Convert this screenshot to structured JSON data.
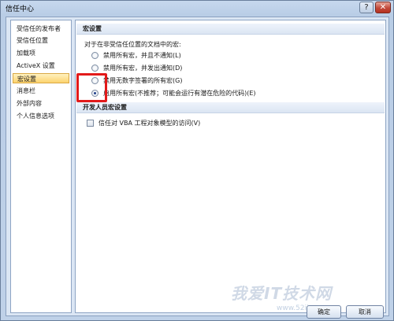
{
  "window": {
    "title": "信任中心",
    "help_glyph": "?",
    "close_glyph": "✕"
  },
  "sidebar": {
    "items": [
      {
        "label": "受信任的发布者"
      },
      {
        "label": "受信任位置"
      },
      {
        "label": "加载项"
      },
      {
        "label": "ActiveX 设置"
      },
      {
        "label": "宏设置",
        "selected": true
      },
      {
        "label": "消息栏"
      },
      {
        "label": "外部内容"
      },
      {
        "label": "个人信息选项"
      }
    ]
  },
  "macro_settings": {
    "header": "宏设置",
    "description": "对于在非受信任位置的文档中的宏:",
    "options": [
      {
        "label": "禁用所有宏，并且不通知(L)",
        "checked": false
      },
      {
        "label": "禁用所有宏，并发出通知(D)",
        "checked": false
      },
      {
        "label": "禁用无数字签署的所有宏(G)",
        "checked": false
      },
      {
        "label": "启用所有宏(不推荐；可能会运行有潜在危险的代码)(E)",
        "checked": true
      }
    ]
  },
  "developer_settings": {
    "header": "开发人员宏设置",
    "trust_vba_label": "信任对 VBA 工程对象模型的访问(V)",
    "trust_vba_checked": false
  },
  "buttons": {
    "ok": "确定",
    "cancel": "取消"
  },
  "watermark": {
    "text": "我爱IT技术网",
    "sub": "www.52ij.com"
  },
  "colors": {
    "selected_item": "#fcd36e",
    "highlight_box": "#e21a1a",
    "radio_dot": "#1f3f8a"
  }
}
